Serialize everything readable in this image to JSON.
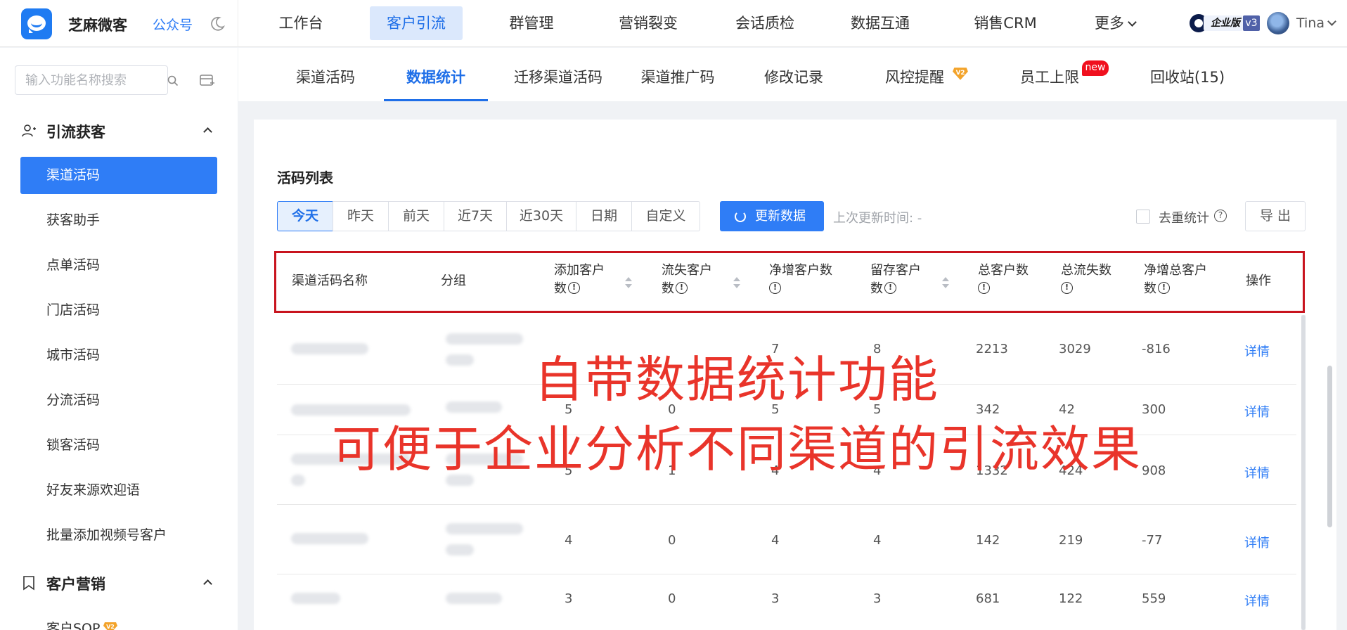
{
  "header": {
    "app_name": "芝麻微客",
    "gzh_label": "公众号",
    "nav": [
      "工作台",
      "客户引流",
      "群管理",
      "营销裂变",
      "会话质检",
      "数据互通",
      "销售CRM",
      "更多"
    ],
    "active_nav": "客户引流",
    "edition_label": "企业版",
    "edition_version": "v3",
    "user_name": "Tina"
  },
  "sidebar": {
    "search_placeholder": "输入功能名称搜索",
    "section1": "引流获客",
    "items": [
      "渠道活码",
      "获客助手",
      "点单活码",
      "门店活码",
      "城市活码",
      "分流活码",
      "锁客活码",
      "好友来源欢迎语",
      "批量添加视频号客户"
    ],
    "active_item": "渠道活码",
    "section2": "客户营销",
    "section2_first_item": "客户SOP",
    "section2_first_item_tag": "V2"
  },
  "tabs": {
    "items": [
      "渠道活码",
      "数据统计",
      "迁移渠道活码",
      "渠道推广码",
      "修改记录",
      "风控提醒",
      "员工上限",
      "回收站(15)"
    ],
    "active": "数据统计",
    "risk_tag": "V2",
    "new_badge": "new"
  },
  "main": {
    "list_title": "活码列表",
    "date_filters": [
      "今天",
      "昨天",
      "前天",
      "近7天",
      "近30天",
      "日期",
      "自定义"
    ],
    "active_filter": "今天",
    "refresh_button": "更新数据",
    "last_update_label": "上次更新时间: -",
    "dedupe_label": "去重统计",
    "export_button": "导 出"
  },
  "table": {
    "columns": {
      "name": "渠道活码名称",
      "group": "分组",
      "added_1": "添加客户",
      "added_2": "数",
      "lost_1": "流失客户",
      "lost_2": "数",
      "net": "净增客户数",
      "retained_1": "留存客户",
      "retained_2": "数",
      "total": "总客户数",
      "total_lost": "总流失数",
      "net_total_1": "净增总客户",
      "net_total_2": "数",
      "action": "操作"
    },
    "rows": [
      {
        "added": "",
        "lost": "",
        "net": "7",
        "retained": "8",
        "total": "2213",
        "total_lost": "3029",
        "net_total": "-816",
        "action": "详情"
      },
      {
        "added": "5",
        "lost": "0",
        "net": "5",
        "retained": "5",
        "total": "342",
        "total_lost": "42",
        "net_total": "300",
        "action": "详情"
      },
      {
        "added": "5",
        "lost": "1",
        "net": "4",
        "retained": "4",
        "total": "1332",
        "total_lost": "424",
        "net_total": "908",
        "action": "详情"
      },
      {
        "added": "4",
        "lost": "0",
        "net": "4",
        "retained": "4",
        "total": "142",
        "total_lost": "219",
        "net_total": "-77",
        "action": "详情"
      },
      {
        "added": "3",
        "lost": "0",
        "net": "3",
        "retained": "3",
        "total": "681",
        "total_lost": "122",
        "net_total": "559",
        "action": "详情"
      }
    ]
  },
  "overlay": {
    "line1": "自带数据统计功能",
    "line2": "可便于企业分析不同渠道的引流效果"
  },
  "colors": {
    "accent": "#2f7df6",
    "header_highlight": "#c8141e",
    "overlay_text": "#e9342a",
    "new_badge": "#f0101e"
  }
}
